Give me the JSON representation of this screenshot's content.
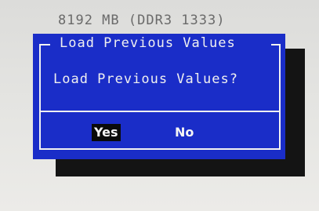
{
  "background": {
    "memory_info": "8192 MB (DDR3 1333)"
  },
  "dialog": {
    "title": "Load Previous Values",
    "message": "Load Previous Values?",
    "buttons": {
      "yes_label": "Yes",
      "no_label": "No",
      "selected": "Yes"
    }
  },
  "colors": {
    "dialog_background": "#1a2dc8",
    "frame_lines": "#f2f2f2",
    "shadow": "#141414",
    "screen_background": "#e4e4e1",
    "selected_button_background": "#0a0a0a",
    "text": "#f0f0f0",
    "background_text": "#6a6a6a"
  }
}
